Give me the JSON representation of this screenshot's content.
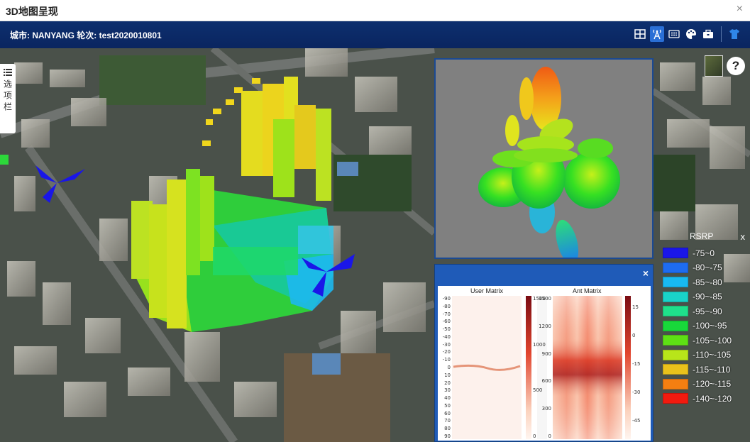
{
  "window": {
    "title": "3D地图呈现",
    "close_glyph": "×"
  },
  "header": {
    "city_label": "城市:",
    "city": "NANYANG",
    "round_label": "轮次:",
    "round": "test2020010801",
    "tools": [
      {
        "name": "table-grid-icon"
      },
      {
        "name": "antenna-tower-icon"
      },
      {
        "name": "dots-grid-icon"
      },
      {
        "name": "palette-icon"
      },
      {
        "name": "toolbox-icon"
      },
      {
        "name": "tshirt-icon"
      }
    ]
  },
  "options_tab": {
    "label": "选项栏"
  },
  "help": {
    "label": "?"
  },
  "matrix_panel": {
    "close_glyph": "×",
    "left_title": "User Matrix",
    "right_title": "Ant Matrix",
    "left_y_ticks": [
      "-90",
      "-80",
      "-70",
      "-60",
      "-50",
      "-40",
      "-30",
      "-20",
      "-10",
      "0",
      "10",
      "20",
      "30",
      "40",
      "50",
      "60",
      "70",
      "80",
      "90"
    ],
    "left_cbar_ticks": [
      "1500",
      "",
      "",
      "",
      "1000",
      "",
      "",
      "",
      "500",
      "",
      "",
      "",
      "0"
    ],
    "right_y_ticks": [
      "1500",
      "",
      "1200",
      "",
      "900",
      "",
      "600",
      "",
      "300",
      "",
      "0"
    ],
    "right_cbar_ticks": [
      "15",
      "0",
      "-15",
      "-30",
      "-45"
    ]
  },
  "legend": {
    "title": "RSRP",
    "close_glyph": "x",
    "items": [
      {
        "label": "-75~0",
        "color": "#1a16e8"
      },
      {
        "label": "-80~-75",
        "color": "#1e6cf0"
      },
      {
        "label": "-85~-80",
        "color": "#18b9f2"
      },
      {
        "label": "-90~-85",
        "color": "#19d3c9"
      },
      {
        "label": "-95~-90",
        "color": "#1fe08b"
      },
      {
        "label": "-100~-95",
        "color": "#18d83a"
      },
      {
        "label": "-105~-100",
        "color": "#5ee014"
      },
      {
        "label": "-110~-105",
        "color": "#b8e51a"
      },
      {
        "label": "-115~-110",
        "color": "#eac21b"
      },
      {
        "label": "-120~-115",
        "color": "#f57f11"
      },
      {
        "label": "-140~-120",
        "color": "#f21a0f"
      }
    ]
  }
}
